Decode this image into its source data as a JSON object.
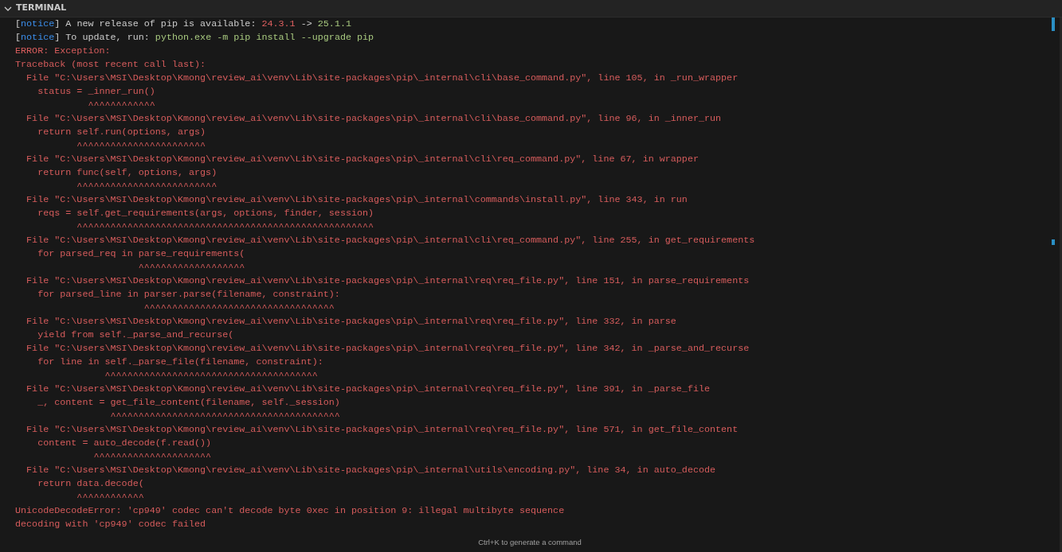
{
  "panel": {
    "title": "TERMINAL",
    "expanded": true
  },
  "lines": [
    {
      "kind": "notice",
      "parts": [
        {
          "text": "["
        },
        {
          "text": "notice",
          "color": "#3b8eea"
        },
        {
          "text": "] A new release of pip is available: "
        },
        {
          "text": "24.3.1",
          "color": "#e06060"
        },
        {
          "text": " -> "
        },
        {
          "text": "25.1.1",
          "color": "#a8c97f"
        }
      ]
    },
    {
      "kind": "notice",
      "parts": [
        {
          "text": "["
        },
        {
          "text": "notice",
          "color": "#3b8eea"
        },
        {
          "text": "] To update, run: "
        },
        {
          "text": "python.exe -m pip install --upgrade pip",
          "color": "#a8c97f"
        }
      ]
    },
    {
      "kind": "error",
      "text": "ERROR: Exception:"
    },
    {
      "kind": "error",
      "text": "Traceback (most recent call last):"
    },
    {
      "kind": "error",
      "text": "  File \"C:\\Users\\MSI\\Desktop\\Kmong\\review_ai\\venv\\Lib\\site-packages\\pip\\_internal\\cli\\base_command.py\", line 105, in _run_wrapper"
    },
    {
      "kind": "error",
      "text": "    status = _inner_run()"
    },
    {
      "kind": "caret",
      "text": "             ^^^^^^^^^^^^"
    },
    {
      "kind": "error",
      "text": "  File \"C:\\Users\\MSI\\Desktop\\Kmong\\review_ai\\venv\\Lib\\site-packages\\pip\\_internal\\cli\\base_command.py\", line 96, in _inner_run"
    },
    {
      "kind": "error",
      "text": "    return self.run(options, args)"
    },
    {
      "kind": "caret",
      "text": "           ^^^^^^^^^^^^^^^^^^^^^^^"
    },
    {
      "kind": "error",
      "text": "  File \"C:\\Users\\MSI\\Desktop\\Kmong\\review_ai\\venv\\Lib\\site-packages\\pip\\_internal\\cli\\req_command.py\", line 67, in wrapper"
    },
    {
      "kind": "error",
      "text": "    return func(self, options, args)"
    },
    {
      "kind": "caret",
      "text": "           ^^^^^^^^^^^^^^^^^^^^^^^^^"
    },
    {
      "kind": "error",
      "text": "  File \"C:\\Users\\MSI\\Desktop\\Kmong\\review_ai\\venv\\Lib\\site-packages\\pip\\_internal\\commands\\install.py\", line 343, in run"
    },
    {
      "kind": "error",
      "text": "    reqs = self.get_requirements(args, options, finder, session)"
    },
    {
      "kind": "caret",
      "text": "           ^^^^^^^^^^^^^^^^^^^^^^^^^^^^^^^^^^^^^^^^^^^^^^^^^^^^^"
    },
    {
      "kind": "error",
      "text": "  File \"C:\\Users\\MSI\\Desktop\\Kmong\\review_ai\\venv\\Lib\\site-packages\\pip\\_internal\\cli\\req_command.py\", line 255, in get_requirements"
    },
    {
      "kind": "error",
      "text": "    for parsed_req in parse_requirements("
    },
    {
      "kind": "caret",
      "text": "                      ^^^^^^^^^^^^^^^^^^^"
    },
    {
      "kind": "error",
      "text": "  File \"C:\\Users\\MSI\\Desktop\\Kmong\\review_ai\\venv\\Lib\\site-packages\\pip\\_internal\\req\\req_file.py\", line 151, in parse_requirements"
    },
    {
      "kind": "error",
      "text": "    for parsed_line in parser.parse(filename, constraint):"
    },
    {
      "kind": "caret",
      "text": "                       ^^^^^^^^^^^^^^^^^^^^^^^^^^^^^^^^^^"
    },
    {
      "kind": "error",
      "text": "  File \"C:\\Users\\MSI\\Desktop\\Kmong\\review_ai\\venv\\Lib\\site-packages\\pip\\_internal\\req\\req_file.py\", line 332, in parse"
    },
    {
      "kind": "error",
      "text": "    yield from self._parse_and_recurse("
    },
    {
      "kind": "error",
      "text": "  File \"C:\\Users\\MSI\\Desktop\\Kmong\\review_ai\\venv\\Lib\\site-packages\\pip\\_internal\\req\\req_file.py\", line 342, in _parse_and_recurse"
    },
    {
      "kind": "error",
      "text": "    for line in self._parse_file(filename, constraint):"
    },
    {
      "kind": "caret",
      "text": "                ^^^^^^^^^^^^^^^^^^^^^^^^^^^^^^^^^^^^^^"
    },
    {
      "kind": "error",
      "text": "  File \"C:\\Users\\MSI\\Desktop\\Kmong\\review_ai\\venv\\Lib\\site-packages\\pip\\_internal\\req\\req_file.py\", line 391, in _parse_file"
    },
    {
      "kind": "error",
      "text": "    _, content = get_file_content(filename, self._session)"
    },
    {
      "kind": "caret",
      "text": "                 ^^^^^^^^^^^^^^^^^^^^^^^^^^^^^^^^^^^^^^^^^"
    },
    {
      "kind": "error",
      "text": "  File \"C:\\Users\\MSI\\Desktop\\Kmong\\review_ai\\venv\\Lib\\site-packages\\pip\\_internal\\req\\req_file.py\", line 571, in get_file_content"
    },
    {
      "kind": "error",
      "text": "    content = auto_decode(f.read())"
    },
    {
      "kind": "caret",
      "text": "              ^^^^^^^^^^^^^^^^^^^^^"
    },
    {
      "kind": "error",
      "text": "  File \"C:\\Users\\MSI\\Desktop\\Kmong\\review_ai\\venv\\Lib\\site-packages\\pip\\_internal\\utils\\encoding.py\", line 34, in auto_decode"
    },
    {
      "kind": "error",
      "text": "    return data.decode("
    },
    {
      "kind": "caret",
      "text": "           ^^^^^^^^^^^^"
    },
    {
      "kind": "error",
      "text": "UnicodeDecodeError: 'cp949' codec can't decode byte 0xec in position 9: illegal multibyte sequence"
    },
    {
      "kind": "error",
      "text": "decoding with 'cp949' codec failed"
    }
  ],
  "hint": "Ctrl+K to generate a command"
}
